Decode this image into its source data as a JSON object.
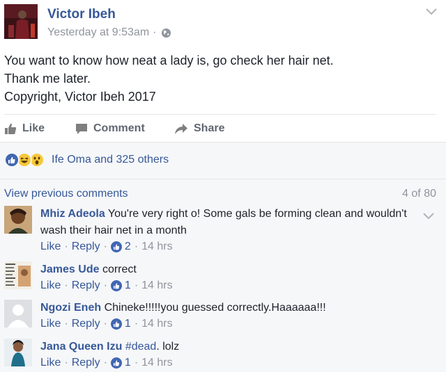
{
  "post": {
    "author": "Victor Ibeh",
    "timestamp": "Yesterday at 9:53am",
    "meta_sep": "·",
    "privacy_icon": "globe-icon",
    "lines": [
      "You want to know how neat a lady is, go check her hair net.",
      "Thank me later.",
      "Copyright, Victor Ibeh 2017"
    ]
  },
  "actions": {
    "like": "Like",
    "comment": "Comment",
    "share": "Share"
  },
  "reactions": {
    "icons": [
      "like-reaction-icon",
      "haha-reaction-icon",
      "wow-reaction-icon"
    ],
    "summary": "Ife Oma and 325 others"
  },
  "comments_section": {
    "view_previous": "View previous comments",
    "count": "4 of 80",
    "items": [
      {
        "name": "Mhiz Adeola",
        "line1": "You're very right o! Some gals be forming clean and wouldn't",
        "line2": "wash their hair net in a month",
        "like": "Like",
        "reply": "Reply",
        "likes": "2",
        "time": "14 hrs"
      },
      {
        "name": "James Ude",
        "line1": "correct",
        "like": "Like",
        "reply": "Reply",
        "likes": "1",
        "time": "14 hrs"
      },
      {
        "name": "Ngozi Eneh",
        "line1": "Chineke!!!!!you guessed correctly.Haaaaaa!!!",
        "like": "Like",
        "reply": "Reply",
        "likes": "1",
        "time": "14 hrs"
      },
      {
        "name": "Jana Queen Izu",
        "hashtag": "#dead",
        "line1": ". lolz",
        "like": "Like",
        "reply": "Reply",
        "likes": "1",
        "time": "14 hrs"
      }
    ]
  },
  "sep": "·",
  "colors": {
    "link_blue": "#365899",
    "like_blue": "#4267b2",
    "meta_gray": "#90949c",
    "panel_bg": "#f6f7f9"
  }
}
